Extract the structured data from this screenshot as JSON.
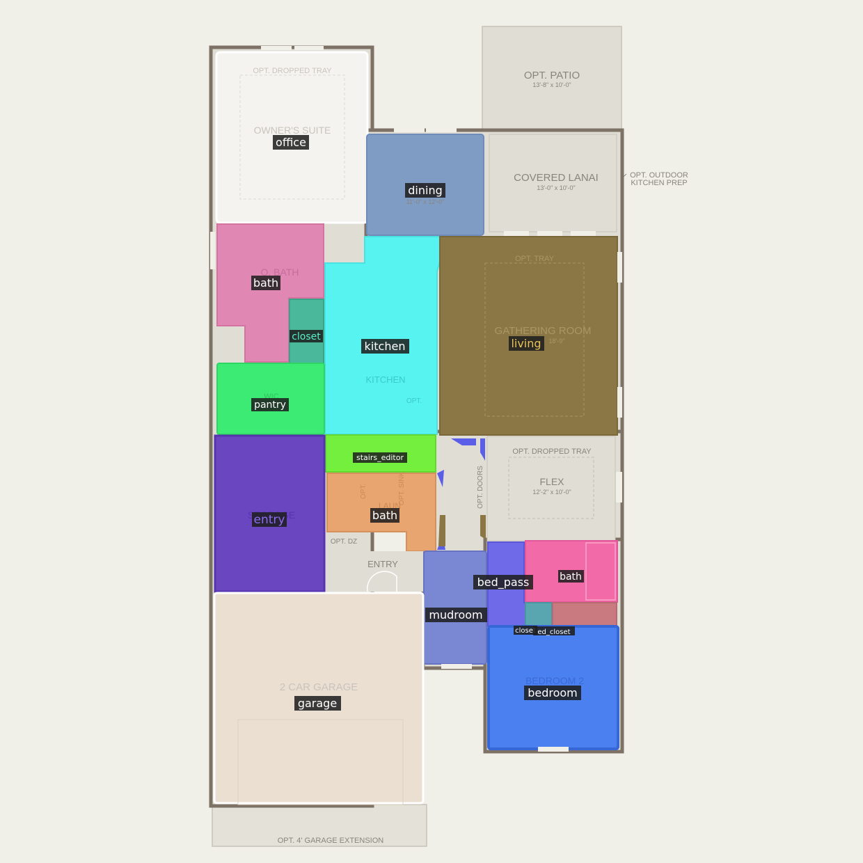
{
  "colors": {
    "background": "#f0efe8",
    "wall": "#7e7266",
    "exterior_area": "#e0ddd4",
    "office": "#f4f3f0",
    "dining": "#7f9cc5",
    "bath": "#e087b3",
    "closet": "#4ab99b",
    "kitchen": "#56f3f1",
    "living": "#8b7746",
    "pantry": "#3ceb74",
    "entry": "#6a47c1",
    "stairs": "#74ef3e",
    "laundry_bath": "#e8a56f",
    "bed_pass": "#6f6be8",
    "bath2": "#f36aa8",
    "closet2": "#5aa6b0",
    "bed_closet": "#c97a80",
    "mudroom": "#7a87d3",
    "bedroom": "#4a80ef",
    "garage": "#ebdfd2",
    "flex_hall": "#e0ddd4"
  },
  "plan_text": {
    "opt_patio": "OPT. PATIO",
    "opt_patio_dim": "13'-8\" x 10'-0\"",
    "covered_lanai": "COVERED LANAI",
    "covered_lanai_dim": "13'-0\" x 10'-0\"",
    "outdoor_kitchen_1": "OPT. OUTDOOR",
    "outdoor_kitchen_2": "KITCHEN PREP",
    "opt_dropped_tray_owner": "OPT. DROPPED TRAY",
    "owners_suite": "OWNER'S SUITE",
    "dining_dim": "11'-0\" x 12'-0\"",
    "o_bath": "O. BATH",
    "opt_tray": "OPT. TRAY",
    "gathering_room": "GATHERING ROOM",
    "gathering_dim": "18'-9\"",
    "kitchen": "KITCHEN",
    "opt_kitchen": "OPT.",
    "wic": "WIC",
    "opt_dropped_tray_flex": "OPT. DROPPED TRAY",
    "flex": "FLEX",
    "flex_dim": "12'-2\" x 10'-0\"",
    "opt_doors": "OPT. DOORS",
    "storage": "STORAGE",
    "opt_laun": "OPT.",
    "laun": "LAUN",
    "opt_sink": "OPT. SINK",
    "opt_dz": "OPT. DZ",
    "entry": "ENTRY",
    "bedroom2": "BEDROOM 2",
    "two_car_garage": "2 CAR GARAGE",
    "garage_extension": "OPT. 4' GARAGE EXTENSION"
  },
  "labels": {
    "office": "office",
    "dining": "dining",
    "bath_owner": "bath",
    "closet_owner": "closet",
    "kitchen": "kitchen",
    "living": "living",
    "pantry": "pantry",
    "stairs_editor": "stairs_editor",
    "entry": "entry",
    "bath_laundry": "bath",
    "bed_pass": "bed_pass",
    "bath_bed": "bath",
    "mudroom": "mudroom",
    "closet_bed": "closet",
    "bed_closet": "ed_closet",
    "bedroom": "bedroom",
    "garage": "garage"
  },
  "label_colors": {
    "office": "#ffffff",
    "dining": "#ffffff",
    "bath_owner": "#ffffff",
    "closet_owner": "#5df0c6",
    "kitchen": "#ffffff",
    "living": "#e8c25a",
    "pantry": "#ffffff",
    "stairs_editor": "#ffffff",
    "entry": "#8c6cf0",
    "bath_laundry": "#ffffff",
    "bed_pass": "#ffffff",
    "bath_bed": "#ffffff",
    "mudroom": "#ffffff",
    "closet_bed": "#ffffff",
    "bed_closet": "#ffffff",
    "bedroom": "#ffffff",
    "garage": "#ffffff"
  }
}
